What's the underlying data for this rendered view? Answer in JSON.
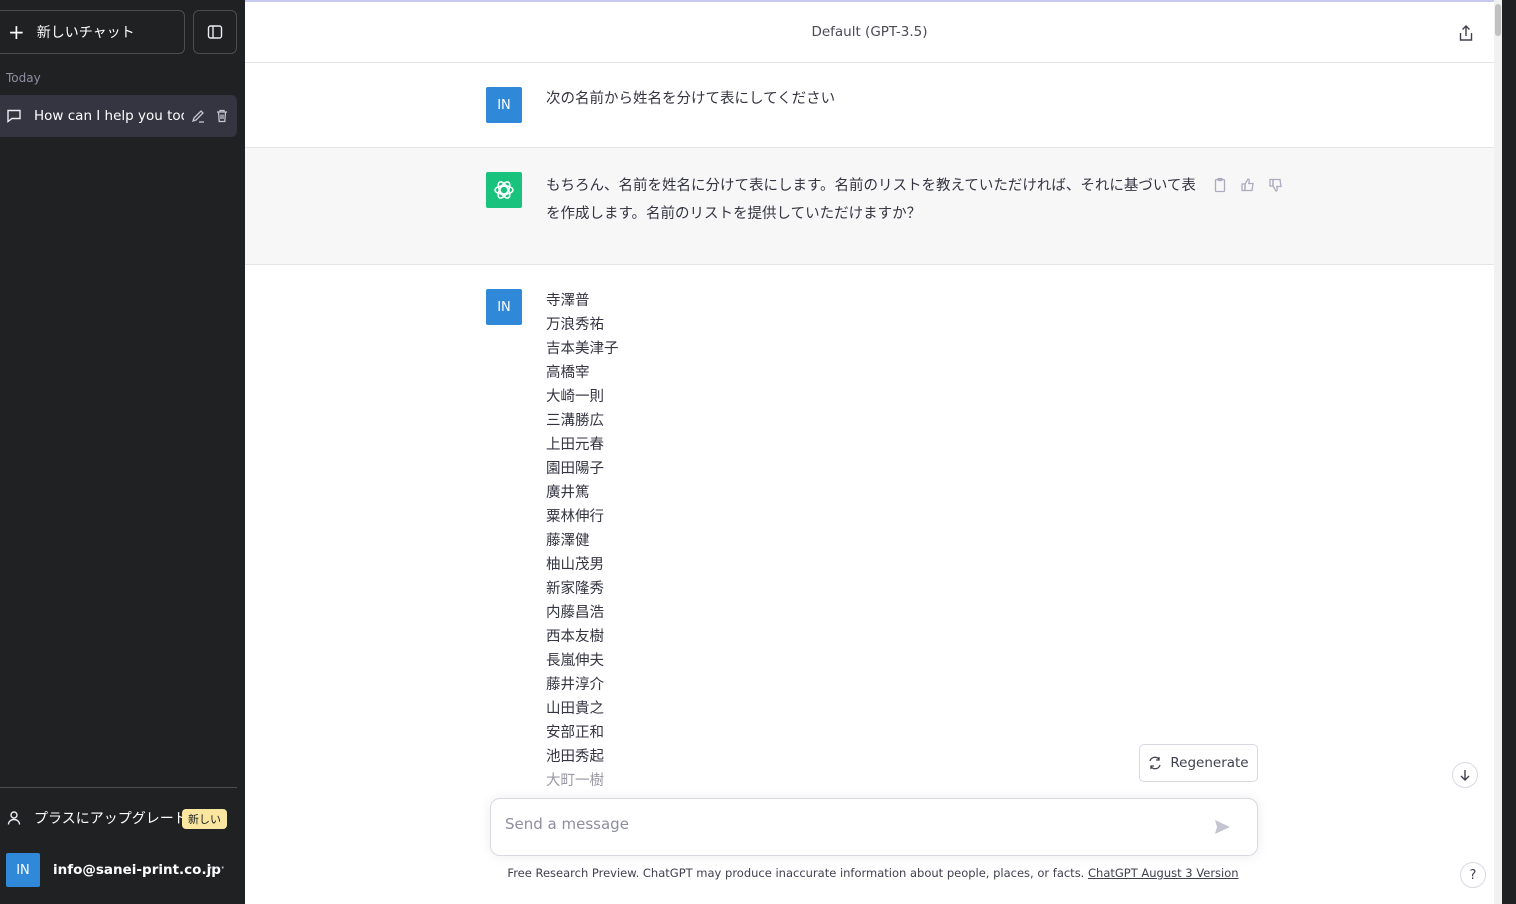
{
  "sidebar": {
    "new_chat_label": "新しいチャット",
    "section_today": "Today",
    "chat_item_title": "How can I help you toda",
    "upgrade_label": "プラスにアップグレード",
    "upgrade_badge": "新しい",
    "user_initials": "IN",
    "user_email": "info@sanei-print.co.jp",
    "more_label": "···"
  },
  "header": {
    "model_title": "Default (GPT-3.5)"
  },
  "messages": {
    "user1_avatar": "IN",
    "user1_text": "次の名前から姓名を分けて表にしてください",
    "bot_text": "もちろん、名前を姓名に分けて表にします。名前のリストを教えていただければ、それに基づいて表を作成します。名前のリストを提供していただけますか？",
    "user2_avatar": "IN",
    "user2_names": [
      "寺澤普",
      "万浪秀祐",
      "吉本美津子",
      "高橋宰",
      "大崎一則",
      "三溝勝広",
      "上田元春",
      "園田陽子",
      "廣井篤",
      "粟林伸行",
      "藤澤健",
      "柚山茂男",
      "新家隆秀",
      "内藤昌浩",
      "西本友樹",
      "長嵐伸夫",
      "藤井淳介",
      "山田貴之",
      "安部正和",
      "池田秀起",
      "大町一樹"
    ]
  },
  "composer": {
    "regenerate_label": "Regenerate",
    "input_placeholder": "Send a message",
    "input_value": ""
  },
  "footer": {
    "text": "Free Research Preview. ChatGPT may produce inaccurate information about people, places, or facts. ",
    "link_text": "ChatGPT August 3 Version"
  },
  "help_label": "?",
  "colors": {
    "sidebar_bg": "#202123",
    "user_avatar": "#2f88d8",
    "bot_avatar": "#19c37d",
    "badge": "#fae69e"
  }
}
